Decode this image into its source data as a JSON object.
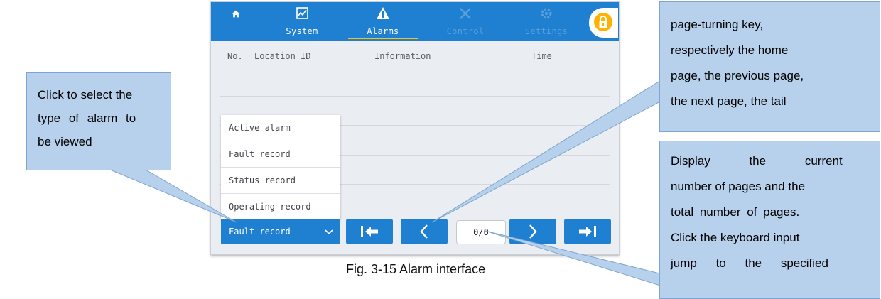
{
  "nav": {
    "home_icon": "home-icon",
    "system_label": "System",
    "alarms_label": "Alarms",
    "control_label": "Control",
    "settings_label": "Settings",
    "lock_icon": "lock-icon"
  },
  "table": {
    "columns": [
      "No.",
      "Location",
      "ID",
      "Information",
      "Time"
    ]
  },
  "alarm_type_menu": {
    "options": [
      "Active alarm",
      "Fault record",
      "Status record",
      "Operating record"
    ],
    "selected": "Fault record"
  },
  "pagination": {
    "first_icon": "first-page-icon",
    "prev_icon": "prev-page-icon",
    "next_icon": "next-page-icon",
    "last_icon": "last-page-icon",
    "page_indicator": "0/0"
  },
  "annotations": {
    "left": [
      "Click to select the",
      "type of alarm to",
      "be viewed"
    ],
    "top_right": [
      "page-turning key,",
      "respectively the home",
      "page, the previous page,",
      "the next page, the tail"
    ],
    "bottom_right": [
      "Display the current",
      "number of pages and the",
      "total number of pages.",
      "Click the keyboard input",
      "jump to the specified"
    ]
  },
  "caption": "Fig. 3-15 Alarm interface",
  "colors": {
    "topbar": "#1f7fd0",
    "accent_underline": "#ffc107",
    "lock": "#ffb300",
    "content_bg": "#eaedf1",
    "callout_fill": "#b7d1ec"
  }
}
